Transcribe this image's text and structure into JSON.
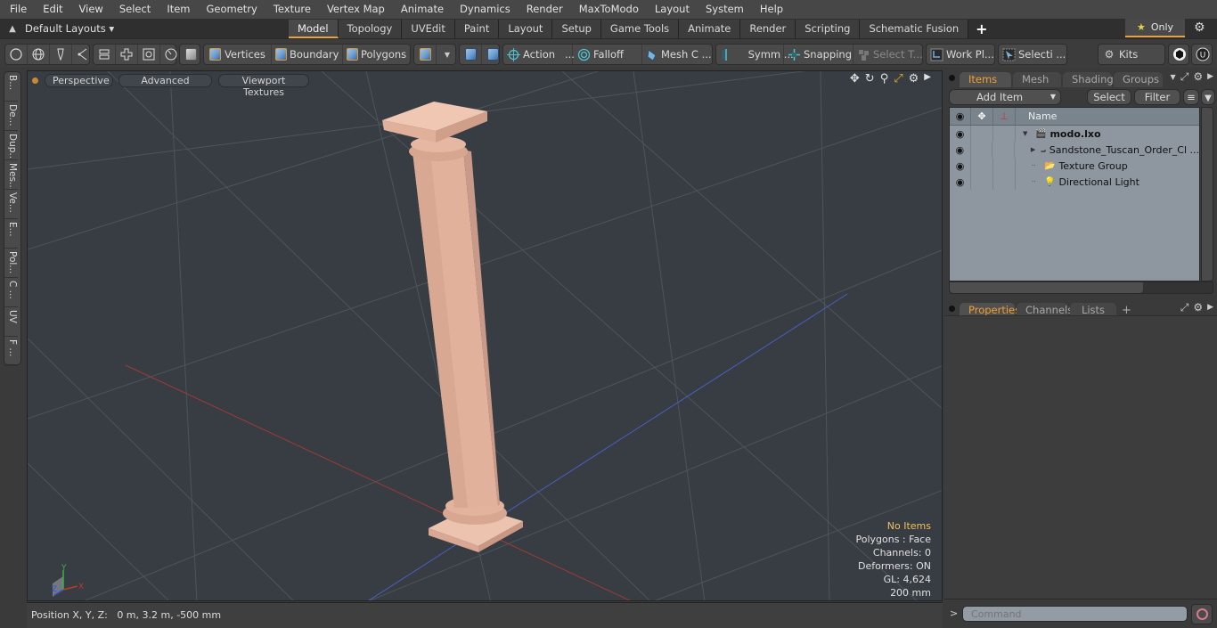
{
  "menubar": {
    "items": [
      "File",
      "Edit",
      "View",
      "Select",
      "Item",
      "Geometry",
      "Texture",
      "Vertex Map",
      "Animate",
      "Dynamics",
      "Render",
      "MaxToModo",
      "Layout",
      "System",
      "Help"
    ]
  },
  "layoutbar": {
    "layout_select": "Default Layouts ▾",
    "tabs": [
      "Model",
      "Topology",
      "UVEdit",
      "Paint",
      "Layout",
      "Setup",
      "Game Tools",
      "Animate",
      "Render",
      "Scripting",
      "Schematic Fusion"
    ],
    "active_tab": "Model",
    "add_tab": "+",
    "only_label": "Only",
    "accent_color": "#e8a040"
  },
  "toolbar": {
    "vertices": "Vertices",
    "boundary": "Boundary",
    "polygons": "Polygons",
    "action": "Action",
    "action_more": "...",
    "falloff": "Falloff",
    "mesh_constraints": "Mesh C ...",
    "symmetry": "Symm ...",
    "snapping": "Snapping",
    "select_through": "Select T...",
    "work_plane": "Work Pl...",
    "selection_sets": "Selecti ...",
    "kits": "Kits"
  },
  "left_tabs": [
    "B...",
    "De...",
    "Dup...",
    "Mes...",
    "Ve...",
    "E...",
    "Pol...",
    "C ...",
    "UV",
    "F ..."
  ],
  "viewport": {
    "view_mode": "Perspective",
    "shading_mode": "Advanced",
    "texture_mode": "Viewport Textures",
    "info": {
      "selection": "No Items",
      "polygons": "Polygons : Face",
      "channels": "Channels: 0",
      "deformers": "Deformers: ON",
      "gl": "GL: 4,624",
      "grid": "200 mm"
    },
    "axis_labels": {
      "x": "X",
      "y": "Y",
      "z": "Z"
    },
    "model_color": "#e4b8a4",
    "background_color": "#373d42"
  },
  "statusbar": {
    "position_label": "Position X, Y, Z:",
    "position_value": "0 m, 3.2 m, -500 mm"
  },
  "items_panel": {
    "tabs": [
      "Items",
      "Mesh ...",
      "Shading",
      "Groups"
    ],
    "active_tab": "Items",
    "add_item": "Add Item",
    "select": "Select",
    "filter": "Filter",
    "column_name": "Name",
    "tree": [
      {
        "label": "modo.lxo",
        "bold": true,
        "expander": "▼",
        "icon": "scene-icon",
        "depth": 0
      },
      {
        "label": "Sandstone_Tuscan_Order_Cl ...",
        "bold": false,
        "expander": "▶",
        "icon": "mesh-locator-icon",
        "depth": 1
      },
      {
        "label": "Texture Group",
        "bold": false,
        "expander": "",
        "icon": "folder-icon",
        "depth": 1
      },
      {
        "label": "Directional Light",
        "bold": false,
        "expander": "",
        "icon": "light-icon",
        "depth": 1
      }
    ]
  },
  "properties_panel": {
    "tabs": [
      "Properties",
      "Channels",
      "Lists"
    ],
    "active_tab": "Properties",
    "add_tab": "+"
  },
  "command": {
    "prompt": ">",
    "placeholder": "Command"
  }
}
